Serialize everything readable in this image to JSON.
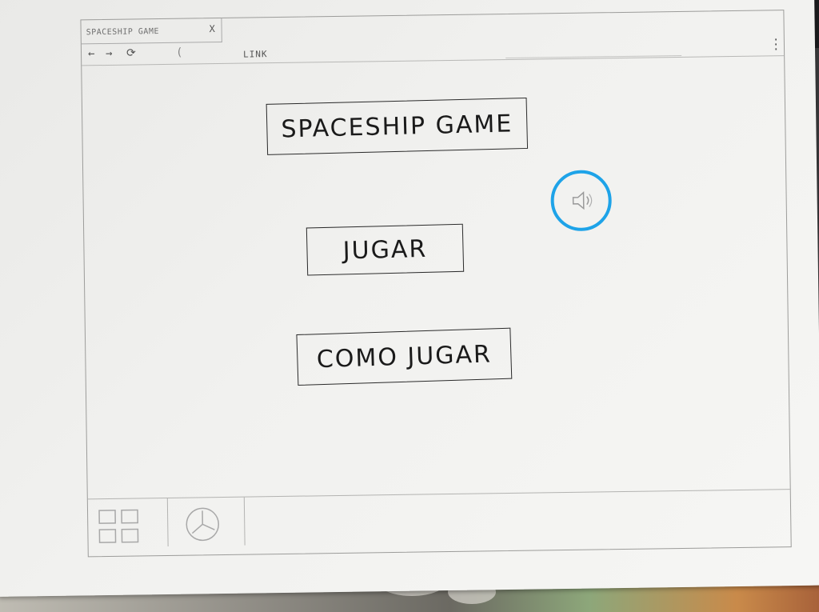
{
  "browser": {
    "tab_title": "SPACESHIP GAME",
    "tab_close": "X",
    "address": "LINK"
  },
  "page": {
    "title": "SPACESHIP GAME",
    "play_label": "JUGAR",
    "how_to_play_label": "COMO JUGAR"
  },
  "icons": {
    "back": "arrow-left-icon",
    "forward": "arrow-right-icon",
    "reload": "reload-icon",
    "menu": "more-vert-icon",
    "sound": "speaker-icon",
    "apps": "grid-icon",
    "dashboard": "dashboard-icon"
  },
  "colors": {
    "sound_ring": "#1ea3e8",
    "ink": "#1a1a1a",
    "pencil": "#8a8a8a"
  }
}
